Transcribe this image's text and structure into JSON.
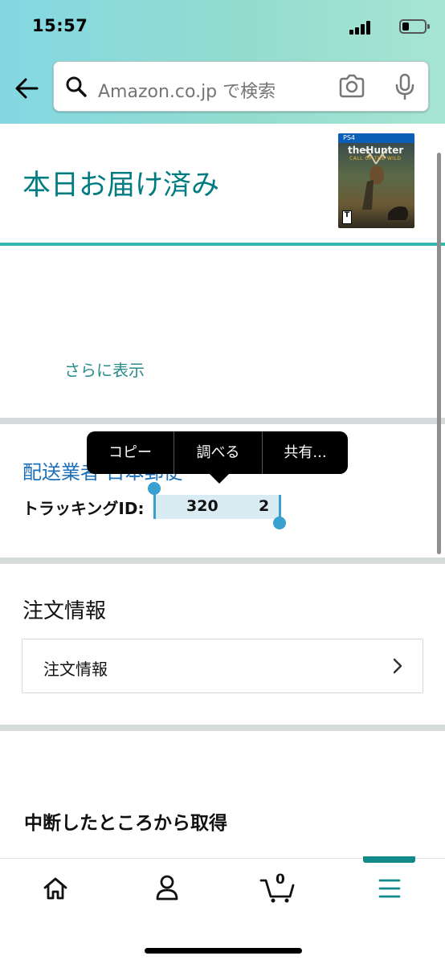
{
  "status_bar": {
    "time": "15:57"
  },
  "search": {
    "placeholder": "Amazon.co.jp で検索"
  },
  "shipment": {
    "status_title": "本日お届け済み",
    "show_more": "さらに表示",
    "carrier": "配送業者 日本郵便",
    "tracking_label": "トラッキングID:",
    "tracking_part1": "320",
    "tracking_part2": "2"
  },
  "product": {
    "platform": "PS4",
    "title": "theHunter",
    "subtitle": "CALL OF THE WILD",
    "rating": "T"
  },
  "context_menu": {
    "items": [
      {
        "label": "コピー"
      },
      {
        "label": "調べる"
      },
      {
        "label": "共有..."
      }
    ]
  },
  "order_info": {
    "section_title": "注文情報",
    "row_label": "注文情報"
  },
  "resume": {
    "title": "中断したところから取得"
  },
  "bottom_nav": {
    "cart_count": "0",
    "items": [
      "home-icon",
      "account-icon",
      "cart-icon",
      "menu-icon"
    ]
  },
  "colors": {
    "accent_teal": "#007b80",
    "link_blue": "#1d70b8",
    "selection_handle": "#3aa0cf"
  }
}
